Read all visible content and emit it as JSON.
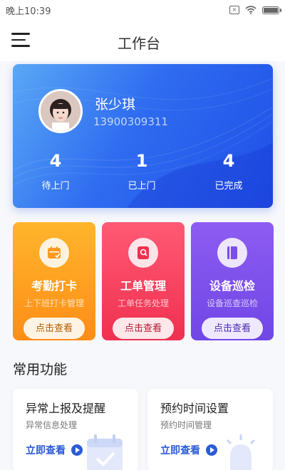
{
  "status_bar": {
    "time": "晚上10:39"
  },
  "header": {
    "title": "工作台"
  },
  "profile": {
    "name": "张少琪",
    "phone": "13900309311",
    "stats": [
      {
        "value": "4",
        "label": "待上门"
      },
      {
        "value": "1",
        "label": "已上门"
      },
      {
        "value": "4",
        "label": "已完成"
      }
    ]
  },
  "features": [
    {
      "title": "考勤打卡",
      "subtitle": "上下班打卡管理",
      "button": "点击查看",
      "icon": "calendar-check-icon"
    },
    {
      "title": "工单管理",
      "subtitle": "工单任务处理",
      "button": "点击查看",
      "icon": "document-search-icon"
    },
    {
      "title": "设备巡检",
      "subtitle": "设备巡查巡检",
      "button": "点击查看",
      "icon": "book-icon"
    }
  ],
  "section": {
    "title": "常用功能"
  },
  "functions": [
    {
      "title": "异常上报及提醒",
      "subtitle": "异常信息处理",
      "link": "立即查看"
    },
    {
      "title": "预约时间设置",
      "subtitle": "预约时间管理",
      "link": "立即查看"
    }
  ],
  "colors": {
    "primary_blue": "#2f6cf0",
    "orange": "#ff9a1f",
    "red": "#f0304f",
    "purple": "#7a4eea",
    "link_blue": "#2a5bd7"
  }
}
